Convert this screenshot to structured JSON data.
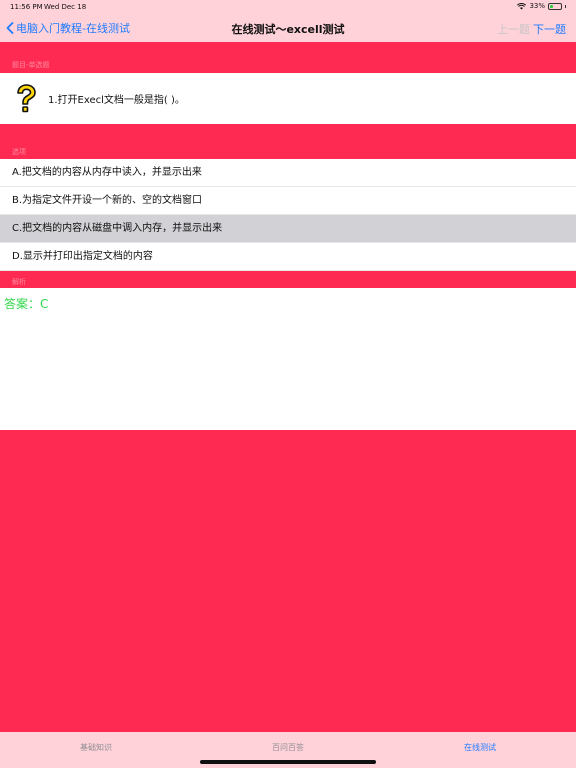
{
  "status": {
    "time": "11:56 PM",
    "date": "Wed Dec 18",
    "battery": "33%",
    "battery_level": 0.33
  },
  "nav": {
    "back_label": "电脑入门教程-在线测试",
    "title": "在线测试～excell测试",
    "prev_label": "上一题",
    "next_label": "下一题"
  },
  "sections": {
    "question_header": "题目-单选题",
    "options_header": "选项",
    "answer_header": "解析"
  },
  "question": {
    "text": "1.打开Execl文档一般是指(    )。"
  },
  "options": [
    {
      "label": "A.把文档的内容从内存中读入，并显示出来",
      "selected": false
    },
    {
      "label": "B.为指定文件开设一个新的、空的文档窗口",
      "selected": false
    },
    {
      "label": "C.把文档的内容从磁盘中调入内存，并显示出来",
      "selected": true
    },
    {
      "label": "D.显示并打印出指定文档的内容",
      "selected": false
    }
  ],
  "answer": {
    "text": "答案：C",
    "color": "#32d74b"
  },
  "tabs": [
    {
      "label": "基础知识",
      "active": false
    },
    {
      "label": "百问百答",
      "active": false
    },
    {
      "label": "在线测试",
      "active": true
    }
  ],
  "colors": {
    "accent": "#1e7bff",
    "background": "#ff2a52",
    "bar": "#ffd2da"
  }
}
